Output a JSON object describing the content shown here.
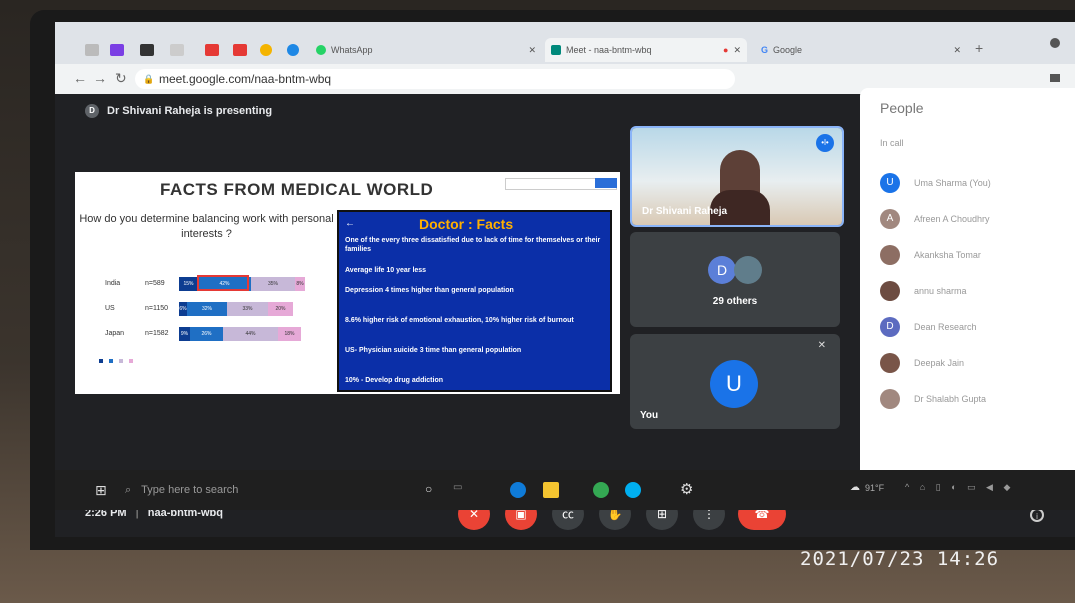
{
  "browser": {
    "tabs": [
      {
        "label": "WhatsApp"
      },
      {
        "label": "Meet - naa-bntm-wbq"
      },
      {
        "label": "Google"
      }
    ],
    "url": "meet.google.com/naa-bntm-wbq"
  },
  "presenter_banner": {
    "avatar_letter": "D",
    "text": "Dr Shivani Raheja is presenting"
  },
  "slide": {
    "title": "FACTS FROM MEDICAL  WORLD",
    "question": "How do you determine balancing work with personal interests ?",
    "chart_rows": [
      {
        "country": "India",
        "n": "n=589",
        "seg_labels": [
          "15%",
          "42%",
          "35%",
          "8%"
        ]
      },
      {
        "country": "US",
        "n": "n=1150",
        "seg_labels": [
          "6%",
          "32%",
          "33%",
          "20%"
        ]
      },
      {
        "country": "Japan",
        "n": "n=1582",
        "seg_labels": [
          "9%",
          "26%",
          "44%",
          "18%"
        ]
      }
    ],
    "chart_segments": [
      0.15,
      0.42,
      0.35,
      0.08,
      0.06,
      0.32,
      0.33,
      0.2,
      0.09,
      0.26,
      0.44,
      0.18
    ],
    "doctor_facts": {
      "title": "Doctor : Facts",
      "items": [
        "One of the every three dissatisfied due to lack of time for themselves or their families",
        "Average life 10 year less",
        "Depression 4 times higher than general population",
        "8.6% higher risk of emotional exhaustion, 10% higher risk of burnout",
        "US- Physician suicide 3 time than general population",
        "10% - Develop drug addiction"
      ]
    }
  },
  "tiles": {
    "presenter": {
      "name": "Dr Shivani Raheja"
    },
    "others": {
      "avatar_letter": "D",
      "label": "29 others"
    },
    "self": {
      "avatar_letter": "U",
      "label": "You"
    }
  },
  "people_panel": {
    "title": "People",
    "section": "In call",
    "members": [
      {
        "name": "Uma Sharma (You)",
        "letter": "U",
        "color": "#1a73e8"
      },
      {
        "name": "Afreen A Choudhry",
        "letter": "A",
        "color": "#a1887f"
      },
      {
        "name": "Akanksha Tomar",
        "letter": "",
        "color": "#8d6e63"
      },
      {
        "name": "annu sharma",
        "letter": "",
        "color": "#6d4c41"
      },
      {
        "name": "Dean Research",
        "letter": "D",
        "color": "#5c6bc0"
      },
      {
        "name": "Deepak Jain",
        "letter": "",
        "color": "#795548"
      },
      {
        "name": "Dr Shalabh Gupta",
        "letter": "",
        "color": "#a1887f"
      }
    ]
  },
  "bottom_bar": {
    "time": "2:26 PM",
    "meeting_code": "naa-bntm-wbq"
  },
  "taskbar": {
    "search_placeholder": "Type here to search",
    "weather": "91°F"
  },
  "photo_timestamp": "2021/07/23  14:26"
}
